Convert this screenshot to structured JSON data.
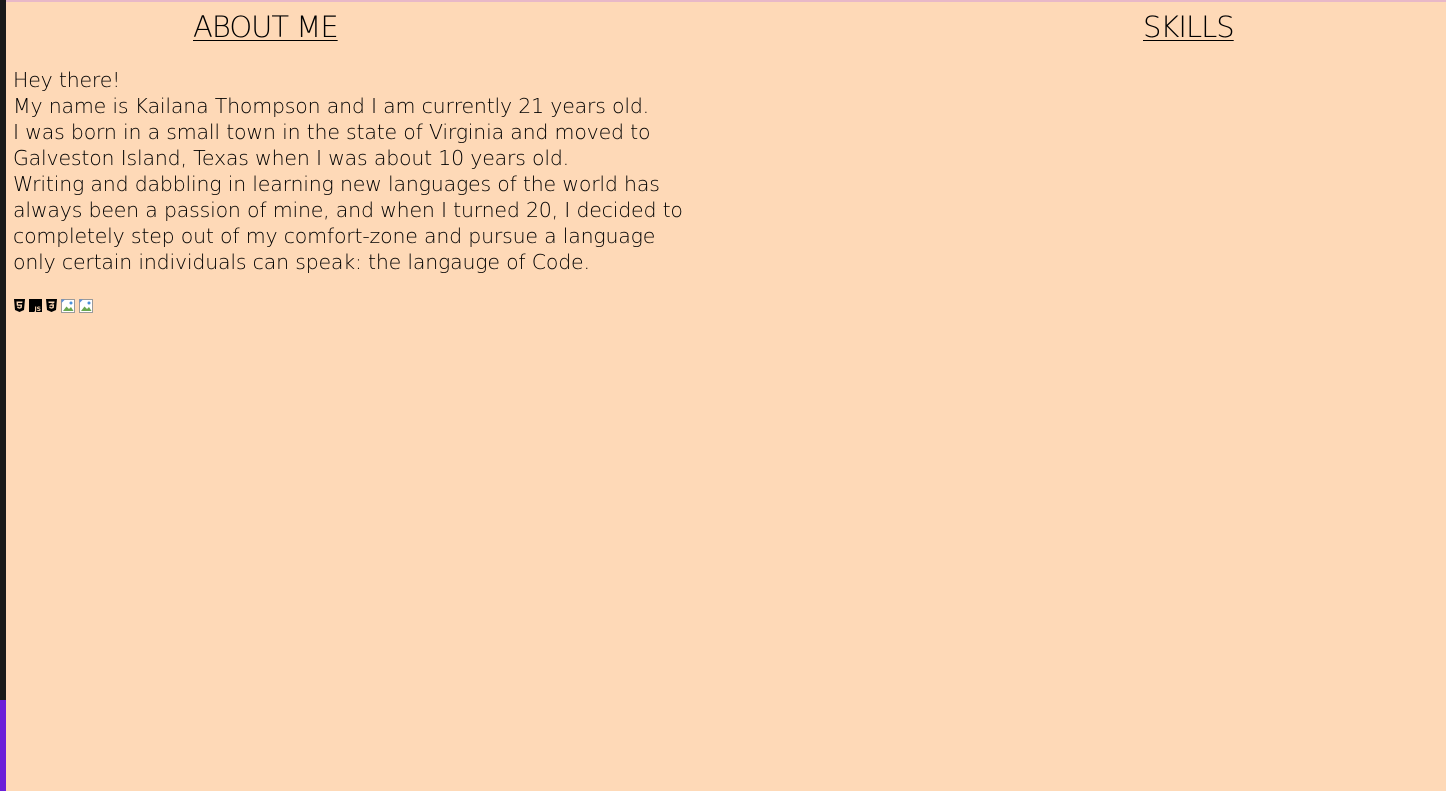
{
  "headings": {
    "about": "ABOUT ME",
    "skills": "SKILLS"
  },
  "about": {
    "lines": [
      "Hey there!",
      "My name is Kailana Thompson and I am currently 21 years old.",
      "I was born in a small town in the state of Virginia and moved to Galveston Island, Texas when I was about 10 years old.",
      "Writing and dabbling in learning new languages of the world has always been a passion of mine, and when I turned 20, I decided to completely step out of my comfort-zone and pursue a language only certain individuals can speak: the langauge of Code."
    ]
  },
  "skill_icons": [
    {
      "name": "html5-icon"
    },
    {
      "name": "javascript-icon",
      "text": "JS"
    },
    {
      "name": "css3-icon"
    },
    {
      "name": "broken-image-icon"
    },
    {
      "name": "broken-image-icon"
    }
  ],
  "colors": {
    "page_background": "#fed9b7",
    "left_strip": "#1a1a1a",
    "accent": "#6b1fd8"
  }
}
